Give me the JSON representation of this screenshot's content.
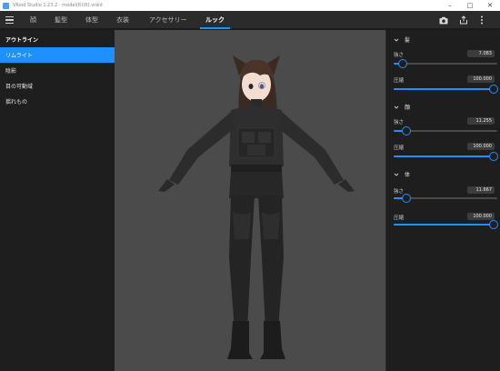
{
  "window": {
    "title": "VRoid Studio 1.23.2 - model(R)(R).vroid",
    "controls": [
      "minimize-icon",
      "maximize-icon",
      "close-icon"
    ]
  },
  "menubar": {
    "tabs": [
      {
        "label": "顔",
        "active": false
      },
      {
        "label": "髪型",
        "active": false
      },
      {
        "label": "体型",
        "active": false
      },
      {
        "label": "衣装",
        "active": false
      },
      {
        "label": "アクセサリー",
        "active": false
      },
      {
        "label": "ルック",
        "active": true
      }
    ],
    "right_icons": [
      "camera-icon",
      "export-icon",
      "more-vertical-icon"
    ]
  },
  "sidebar": {
    "items": [
      {
        "label": "アウトライン",
        "type": "header"
      },
      {
        "label": "リムライト",
        "type": "selected"
      },
      {
        "label": "陰影",
        "type": "item"
      },
      {
        "label": "目の可動域",
        "type": "item"
      },
      {
        "label": "揺れもの",
        "type": "item"
      }
    ]
  },
  "panel": {
    "sections": [
      {
        "title": "髪",
        "sliders": [
          {
            "label": "強さ",
            "value_text": "7.083",
            "fraction": 0.09
          },
          {
            "label": "圧縮",
            "value_text": "100.000",
            "fraction": 1.0
          }
        ]
      },
      {
        "title": "顔",
        "sliders": [
          {
            "label": "強さ",
            "value_text": "11.255",
            "fraction": 0.12
          },
          {
            "label": "圧縮",
            "value_text": "100.000",
            "fraction": 1.0
          }
        ]
      },
      {
        "title": "体",
        "sliders": [
          {
            "label": "強さ",
            "value_text": "11.667",
            "fraction": 0.12
          },
          {
            "label": "圧縮",
            "value_text": "100.000",
            "fraction": 1.0
          }
        ]
      }
    ]
  },
  "colors": {
    "accent": "#1e90ff",
    "viewport_bg": "#4b4b4b"
  }
}
